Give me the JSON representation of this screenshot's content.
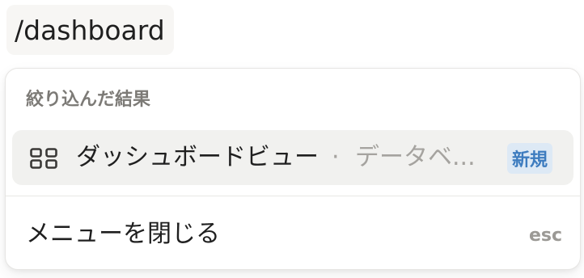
{
  "editor": {
    "slash_text": "/dashboard"
  },
  "menu": {
    "section_label": "絞り込んだ結果",
    "result": {
      "icon": "grid-icon",
      "title": "ダッシュボードビュー",
      "separator": "·",
      "subtitle": "データベ...",
      "badge": "新規"
    },
    "close": {
      "label": "メニューを閉じる",
      "shortcut": "esc"
    }
  },
  "colors": {
    "badge_bg": "#dde9f5",
    "badge_text": "#3d7cbf",
    "highlight_bg": "#f1f1ef",
    "muted_text": "#a5a39f"
  }
}
